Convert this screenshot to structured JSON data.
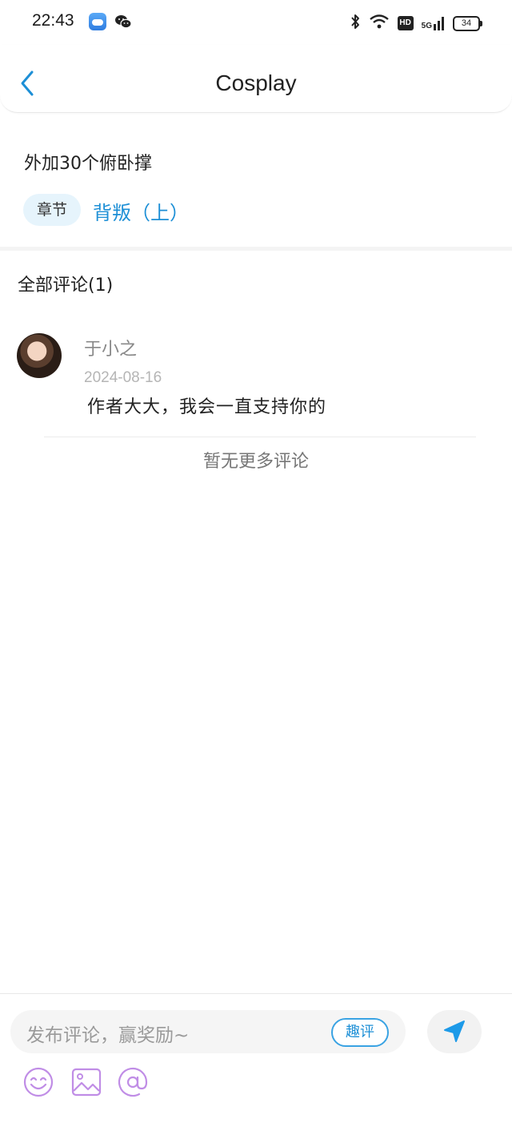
{
  "status_bar": {
    "time": "22:43",
    "signal_label": "5G",
    "hd_label": "HD",
    "battery_level": "34"
  },
  "header": {
    "title": "Cosplay"
  },
  "chapter": {
    "title": "外加30个俯卧撑",
    "tag_label": "章节",
    "link_text": "背叛（上）"
  },
  "comments": {
    "header": "全部评论(1)",
    "items": [
      {
        "username": "于小之",
        "date": "2024-08-16",
        "text": "作者大大，我会一直支持你的"
      }
    ],
    "no_more_text": "暂无更多评论"
  },
  "composer": {
    "placeholder": "发布评论，赢奖励~",
    "fun_comment_label": "趣评"
  },
  "colors": {
    "accent": "#1d8fd6",
    "tag_bg": "#e6f4fc",
    "toolbar_icon": "#b57be0"
  },
  "icons": [
    "back-arrow-icon",
    "send-icon",
    "emoji-icon",
    "image-icon",
    "mention-icon",
    "bluetooth-icon",
    "wifi-icon",
    "weather-icon",
    "wechat-icon"
  ]
}
